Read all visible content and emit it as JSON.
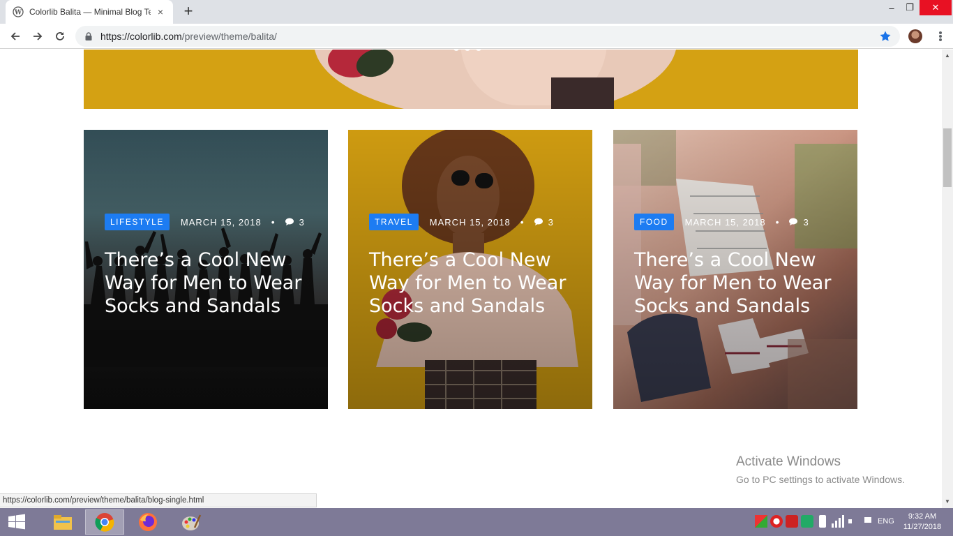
{
  "browser": {
    "tab_title": "Colorlib Balita — Minimal Blog Te",
    "tab_close": "×",
    "new_tab": "+",
    "url_host": "https://colorlib.com",
    "url_path": "/preview/theme/balita/",
    "window_controls": {
      "minimize": "–",
      "restore": "❐",
      "close": "✕"
    }
  },
  "page": {
    "hero_slider_dots": 3,
    "cards": [
      {
        "category": "Lifestyle",
        "date": "March 15, 2018",
        "separator": "•",
        "comments": "3",
        "title": "There’s a Cool New Way for Men to Wear Socks and Sandals",
        "image": "crowd-sunset"
      },
      {
        "category": "Travel",
        "date": "March 15, 2018",
        "separator": "•",
        "comments": "3",
        "title": "There’s a Cool New Way for Men to Wear Socks and Sandals",
        "image": "woman-yellow"
      },
      {
        "category": "Food",
        "date": "March 15, 2018",
        "separator": "•",
        "comments": "3",
        "title": "There’s a Cool New Way for Men to Wear Socks and Sandals",
        "image": "map-railway"
      }
    ],
    "badge_color": "#1d7cf2"
  },
  "watermark": {
    "line1": "Activate Windows",
    "line2": "Go to PC settings to activate Windows."
  },
  "status_bar": {
    "hover_url": "https://colorlib.com/preview/theme/balita/blog-single.html"
  },
  "taskbar": {
    "apps": [
      "file-explorer",
      "chrome",
      "firefox",
      "paint"
    ],
    "language": "ENG",
    "time": "9:32 AM",
    "date": "11/27/2018"
  }
}
